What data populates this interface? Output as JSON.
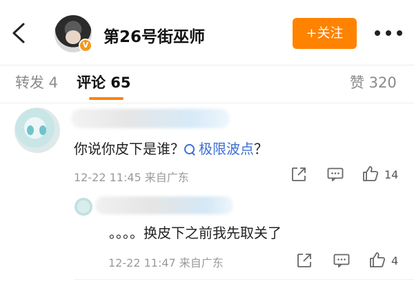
{
  "header": {
    "back_icon": "chevron-left-icon",
    "title": "第26号街巫师",
    "verified_badge": "V",
    "follow_label": "+关注",
    "more_icon": "more-dots-icon",
    "accent_color": "#ff8200"
  },
  "tabs": [
    {
      "label": "转发 4",
      "active": false
    },
    {
      "label": "评论 65",
      "active": true
    },
    {
      "label": "赞 320",
      "active": false
    }
  ],
  "comments": [
    {
      "text_prefix": "你说你皮下是谁？",
      "link_text": "极限波点",
      "text_suffix": "？",
      "meta": "12-22 11:45 来自广东",
      "like_count": "14",
      "link_color": "#3b6fd6"
    }
  ],
  "reply": {
    "text": "。。。。换皮下之前我先取关了",
    "meta": "12-22 11:47 来自广东",
    "like_count": "4"
  }
}
